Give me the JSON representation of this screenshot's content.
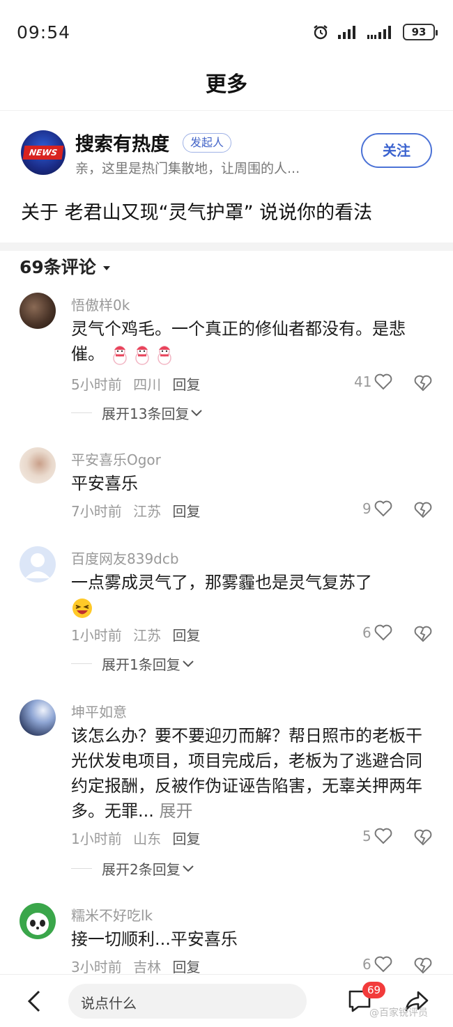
{
  "status_bar": {
    "time": "09:54",
    "battery": "93"
  },
  "nav": {
    "title": "更多"
  },
  "topic": {
    "avatar_text": "NEWS",
    "name": "搜索有热度",
    "badge": "发起人",
    "description": "亲，这里是热门集散地，让周围的人...",
    "follow_label": "关注",
    "question": "关于 老君山又现“灵气护罩” 说说你的看法"
  },
  "comments_header": {
    "count_label": "69条评论"
  },
  "comments": [
    {
      "user": "悟傲样0k",
      "text": "灵气个鸡毛。一个真正的修仙者都没有。是悲催。",
      "emoji_count": 3,
      "time": "5小时前",
      "location": "四川",
      "reply_label": "回复",
      "likes": "41",
      "expand_label": "展开13条回复"
    },
    {
      "user": "平安喜乐Ogor",
      "text": "平安喜乐",
      "time": "7小时前",
      "location": "江苏",
      "reply_label": "回复",
      "likes": "9"
    },
    {
      "user": "百度网友839dcb",
      "text": "一点雾成灵气了，那雾霾也是灵气复苏了",
      "time": "1小时前",
      "location": "江苏",
      "reply_label": "回复",
      "likes": "6",
      "expand_label": "展开1条回复"
    },
    {
      "user": "坤平如意",
      "text": "该怎么办？要不要迎刃而解？帮日照市的老板干光伏发电项目，项目完成后，老板为了逃避合同约定报酬，反被作伪证诬告陷害，无辜关押两年多。无罪...",
      "more_label": "展开",
      "time": "1小时前",
      "location": "山东",
      "reply_label": "回复",
      "likes": "5",
      "expand_label": "展开2条回复"
    },
    {
      "user": "糯米不好吃lk",
      "text": "接一切顺利...平安喜乐",
      "time": "3小时前",
      "location": "吉林",
      "reply_label": "回复",
      "likes": "6"
    }
  ],
  "bottom_bar": {
    "input_placeholder": "说点什么",
    "comment_badge": "69",
    "watermark": "@百家锐评员"
  }
}
